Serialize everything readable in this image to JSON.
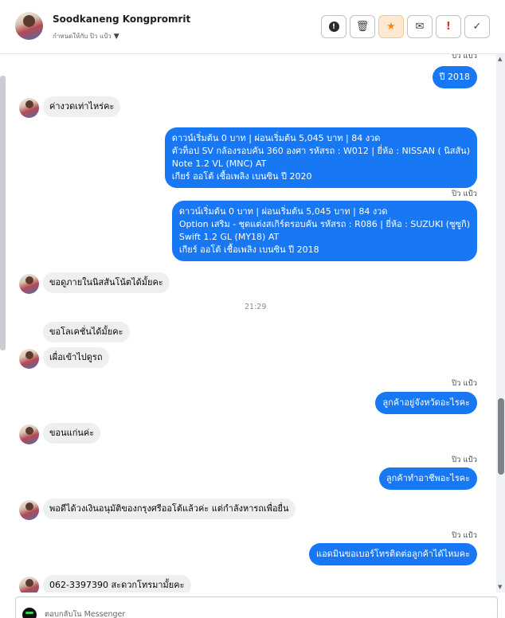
{
  "header": {
    "contact_name": "Soodkaneng Kongpromrit",
    "assign_label": "กำหนดให้กับ ปิว แป้ว",
    "actions": [
      {
        "name": "info",
        "glyph": "!"
      },
      {
        "name": "delete",
        "glyph": "🗑"
      },
      {
        "name": "star",
        "glyph": "★"
      },
      {
        "name": "mail",
        "glyph": "✉"
      },
      {
        "name": "spam",
        "glyph": "!"
      },
      {
        "name": "done",
        "glyph": "✓"
      }
    ]
  },
  "thread": {
    "messages": [
      {
        "id": "m1_sender",
        "sender": "ปิว แป้ว"
      },
      {
        "id": "m1",
        "dir": "out",
        "lines": [
          "ปี 2018"
        ]
      },
      {
        "id": "m2",
        "dir": "in",
        "text": "ค่างวดเท่าไหร่คะ"
      },
      {
        "id": "m3",
        "dir": "out",
        "lines": [
          "ดาวน์เริ่มต้น 0 บาท | ผ่อนเริ่มต้น 5,045 บาท | 84 งวด",
          " ตัวท็อป SV กล้องรอบคัน 360 องศา  รหัสรถ : W012 |  ยี่ห้อ : NISSAN ( นิสสัน)",
          "Note 1.2 VL (MNC) AT",
          " เกียร์ ออโต้  เชื้อเพลิง เบนซิน  ปี 2020"
        ]
      },
      {
        "id": "m4_sender",
        "sender": "ปิว แป้ว"
      },
      {
        "id": "m4",
        "dir": "out",
        "lines": [
          "ดาวน์เริ่มต้น 0 บาท | ผ่อนเริ่มต้น 5,045 บาท | 84 งวด",
          " Option เสริม - ชุดแต่งสเกิร์ตรอบคัน  รหัสรถ : R086 |  ยี่ห้อ : SUZUKI (ซูซูกิ)",
          "Swift 1.2 GL (MY18) AT",
          " เกียร์ ออโต้  เชื้อเพลิง เบนซิน  ปี 2018"
        ]
      },
      {
        "id": "m5",
        "dir": "in",
        "text": "ขอดูภายในนิสสันโน้ตได้มั้ยคะ"
      },
      {
        "id": "time1",
        "time": "21:29"
      },
      {
        "id": "m6",
        "dir": "in",
        "text": "ขอโลเคชั่นได้มั้ยคะ"
      },
      {
        "id": "m7",
        "dir": "in",
        "text": "เผื่อเข้าไปดูรถ"
      },
      {
        "id": "m8_sender",
        "sender": "ปิว แป้ว"
      },
      {
        "id": "m8",
        "dir": "out",
        "lines": [
          "ลูกค้าอยู่จังหวัดอะไรคะ"
        ]
      },
      {
        "id": "m9",
        "dir": "in",
        "text": "ขอนแก่นค่ะ"
      },
      {
        "id": "m10_sender",
        "sender": "ปิว แป้ว"
      },
      {
        "id": "m10",
        "dir": "out",
        "lines": [
          "ลูกค้าทำอาชีพอะไรคะ"
        ]
      },
      {
        "id": "m11",
        "dir": "in",
        "text": "พอดีได้วงเงินอนุมัติของกรุงศรีออโต้แล้วค่ะ แต่กำลังหารถเพื่อยื่น"
      },
      {
        "id": "m12_sender",
        "sender": "ปิว แป้ว"
      },
      {
        "id": "m12",
        "dir": "out",
        "lines": [
          "แอดมินขอเบอร์โทรติดต่อลูกค้าได้ไหมคะ"
        ]
      },
      {
        "id": "m13",
        "dir": "in",
        "text": "062-3397390 สะดวกโทรมามั้ยคะ"
      }
    ]
  },
  "composer": {
    "placeholder": "ตอบกลับใน Messenger"
  },
  "colors": {
    "outgoing_bubble": "#1877f2",
    "incoming_bubble": "#eeeff1",
    "star_accent": "#f28a1e",
    "alert_accent": "#e02f2f"
  }
}
